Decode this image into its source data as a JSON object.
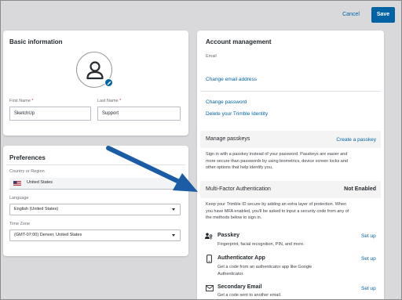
{
  "topbar": {
    "cancel_label": "Cancel",
    "save_label": "Save"
  },
  "basic": {
    "title": "Basic information",
    "first_name_label": "First Name",
    "first_name_value": "SketchUp",
    "last_name_label": "Last Name",
    "last_name_value": "Support",
    "required_mark": "*"
  },
  "prefs": {
    "title": "Preferences",
    "country_label": "Country or Region",
    "country_value": "United States",
    "language_label": "Language",
    "language_value": "English (United States)",
    "timezone_label": "Time Zone",
    "timezone_value": "(GMT-07:00) Denver, United States"
  },
  "account": {
    "title": "Account management",
    "email_label": "Email",
    "change_email": "Change email address",
    "change_password": "Change password",
    "delete_identity": "Delete your Trimble Identity",
    "passkeys_title": "Manage passkeys",
    "create_passkey": "Create a passkey",
    "passkeys_desc_1": "Sign in with a passkey instead of your password. Passkeys are easier and",
    "passkeys_desc_2": "more secure than passwords by using biometrics, device screen locks and",
    "passkeys_desc_3": "other options that help identify you.",
    "mfa_title": "Multi-Factor Authentication",
    "mfa_status": "Not Enabled",
    "mfa_desc_1": "Keep your Trimble ID secure by adding an extra layer of protection. When",
    "mfa_desc_2": "you have MFA enabled, you'll be asked to input a security code from any of",
    "mfa_desc_3": "the methods below to sign in.",
    "methods": [
      {
        "title": "Passkey",
        "desc_1": "Fingerprint, facial recognition, PIN, and more.",
        "desc_2": "",
        "action": "Set up",
        "icon": "passkey-icon"
      },
      {
        "title": "Authenticator App",
        "desc_1": "Get a code from an authenticator app like Google",
        "desc_2": "Authenticator.",
        "action": "Set up",
        "icon": "phone-icon"
      },
      {
        "title": "Secondary Email",
        "desc_1": "Get a code sent to another email.",
        "desc_2": "",
        "action": "Set up",
        "icon": "envelope-icon"
      }
    ]
  },
  "colors": {
    "accent": "#0063a3",
    "background": "#d9d9dc",
    "arrow": "#1a5da6"
  }
}
